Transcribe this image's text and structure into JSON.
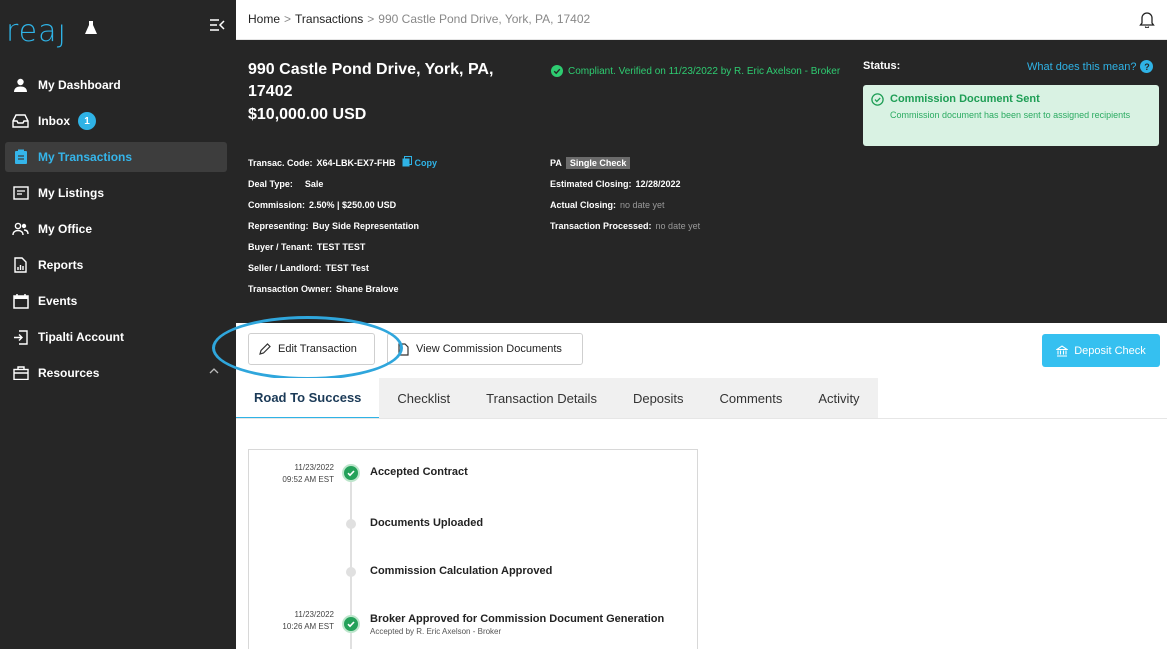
{
  "app": {
    "logo_text": "reaȷ",
    "accent": "#2fb3e6"
  },
  "sidebar": {
    "items": [
      {
        "label": "My Dashboard",
        "icon": "person-icon"
      },
      {
        "label": "Inbox",
        "icon": "inbox-icon",
        "badge": "1"
      },
      {
        "label": "My Transactions",
        "icon": "clipboard-icon",
        "active": true
      },
      {
        "label": "My Listings",
        "icon": "listing-icon"
      },
      {
        "label": "My Office",
        "icon": "people-icon"
      },
      {
        "label": "Reports",
        "icon": "report-icon"
      },
      {
        "label": "Events",
        "icon": "calendar-icon"
      },
      {
        "label": "Tipalti Account",
        "icon": "login-icon"
      },
      {
        "label": "Resources",
        "icon": "briefcase-icon"
      }
    ]
  },
  "breadcrumb": {
    "home": "Home",
    "transactions": "Transactions",
    "current": "990 Castle Pond Drive, York, PA, 17402"
  },
  "header": {
    "address": "990 Castle Pond Drive, York, PA, 17402",
    "price": "$10,000.00 USD",
    "compliance": "Compliant. Verified on 11/23/2022 by R. Eric Axelson - Broker",
    "status_label": "Status:",
    "what_link": "What does this mean?",
    "status_title": "Commission Document Sent",
    "status_desc": "Commission document has been sent to assigned recipients"
  },
  "details_left": {
    "code_label": "Transac. Code:",
    "code_value": "X64-LBK-EX7-FHB",
    "copy_label": "Copy",
    "deal_label": "Deal Type:",
    "deal_value": "Sale",
    "commission_label": "Commission:",
    "commission_value": "2.50% | $250.00 USD",
    "representing_label": "Representing:",
    "representing_value": "Buy Side Representation",
    "buyer_label": "Buyer / Tenant:",
    "buyer_value": "TEST TEST",
    "seller_label": "Seller / Landlord:",
    "seller_value": "TEST Test",
    "owner_label": "Transaction Owner:",
    "owner_value": "Shane Bralove"
  },
  "details_right": {
    "state": "PA",
    "check_tag": "Single Check",
    "est_label": "Estimated Closing:",
    "est_value": "12/28/2022",
    "actual_label": "Actual Closing:",
    "actual_value": "no date yet",
    "processed_label": "Transaction Processed:",
    "processed_value": "no date yet"
  },
  "actions": {
    "edit": "Edit Transaction",
    "view_docs": "View Commission Documents",
    "deposit": "Deposit Check"
  },
  "tabs": [
    "Road To Success",
    "Checklist",
    "Transaction Details",
    "Deposits",
    "Comments",
    "Activity"
  ],
  "timeline": [
    {
      "date": "11/23/2022",
      "time": "09:52 AM EST",
      "title": "Accepted Contract",
      "done": true,
      "sub": ""
    },
    {
      "date": "",
      "time": "",
      "title": "Documents Uploaded",
      "done": false,
      "sub": ""
    },
    {
      "date": "",
      "time": "",
      "title": "Commission Calculation Approved",
      "done": false,
      "sub": ""
    },
    {
      "date": "11/23/2022",
      "time": "10:26 AM EST",
      "title": "Broker Approved for Commission Document Generation",
      "done": true,
      "sub": "Accepted by R. Eric Axelson - Broker"
    }
  ]
}
